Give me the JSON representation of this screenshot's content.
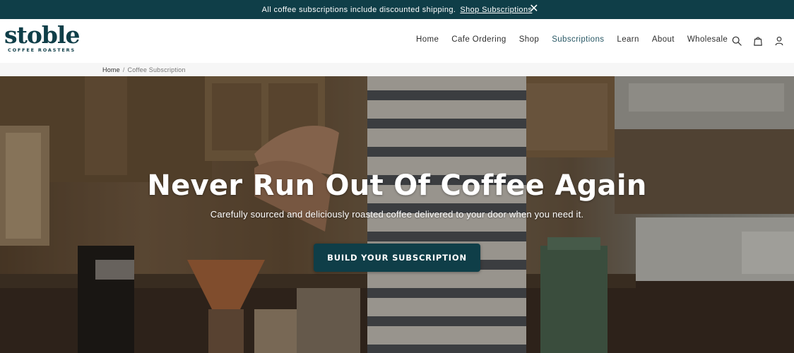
{
  "announcement": {
    "message": "All coffee subscriptions include discounted shipping.",
    "link_label": "Shop Subscriptions",
    "close_icon": "close-icon"
  },
  "brand": {
    "name": "stoble",
    "tagline": "COFFEE ROASTERS",
    "color": "#0f3e48"
  },
  "nav": {
    "items": [
      {
        "label": "Home"
      },
      {
        "label": "Cafe Ordering"
      },
      {
        "label": "Shop"
      },
      {
        "label": "Subscriptions",
        "active": true
      },
      {
        "label": "Learn"
      },
      {
        "label": "About"
      },
      {
        "label": "Wholesale"
      }
    ],
    "icons": [
      "search-icon",
      "shopping-bag-icon",
      "account-icon"
    ]
  },
  "breadcrumb": {
    "home": "Home",
    "separator": "/",
    "current": "Coffee Subscription"
  },
  "hero": {
    "title": "Never Run Out Of Coffee Again",
    "subtitle": "Carefully sourced and deliciously roasted coffee delivered to your door when you need it.",
    "cta_label": "BUILD YOUR SUBSCRIPTION",
    "cta_color": "#0f3e48"
  }
}
